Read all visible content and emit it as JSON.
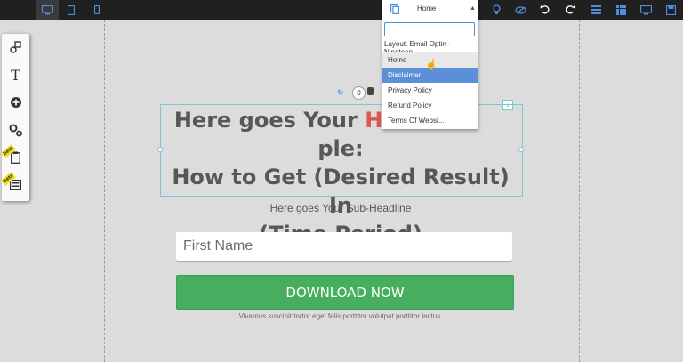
{
  "topbar": {
    "page_select_value": "Home",
    "device_icons": [
      "desktop-icon",
      "tablet-icon",
      "mobile-icon"
    ],
    "right_icons": [
      "lightbulb-icon",
      "hide-icon",
      "undo-icon",
      "redo-icon",
      "menu-icon",
      "grid-icon",
      "monitor-icon",
      "save-icon"
    ]
  },
  "dropdown": {
    "search_value": "",
    "group_label": "Layout: Email Optin - Nineteen",
    "items": [
      "Home",
      "Disclaimer",
      "Privacy Policy",
      "Refund Policy",
      "Terms Of Websi..."
    ],
    "hovered": "Home",
    "selected": "Disclaimer"
  },
  "left_toolbar": {
    "icons": [
      "link-icon",
      "text-icon",
      "add-icon",
      "settings-icon",
      "clipboard-icon",
      "layout-icon"
    ],
    "beta_label": "beta"
  },
  "page": {
    "counter": "0",
    "headline_part1": "Here goes Your ",
    "headline_highlight": "Headl",
    "headline_hidden_gap": "",
    "headline_part2": "ple:",
    "headline_line2": "How to Get (Desired Result) In",
    "headline_line3": "(Time Period)",
    "subheadline": "Here goes Your Sub-Headline",
    "first_name_placeholder": "First Name",
    "cta_label": "DOWNLOAD NOW",
    "disclaimer": "Vivamus suscipit tortor eget felis porttitor volutpat porttitor lectus."
  },
  "colors": {
    "topbar": "#202020",
    "accent": "#4a90e2",
    "highlight": "#e05555",
    "cta": "#47ae60",
    "selected_item": "#5b8fd8"
  }
}
